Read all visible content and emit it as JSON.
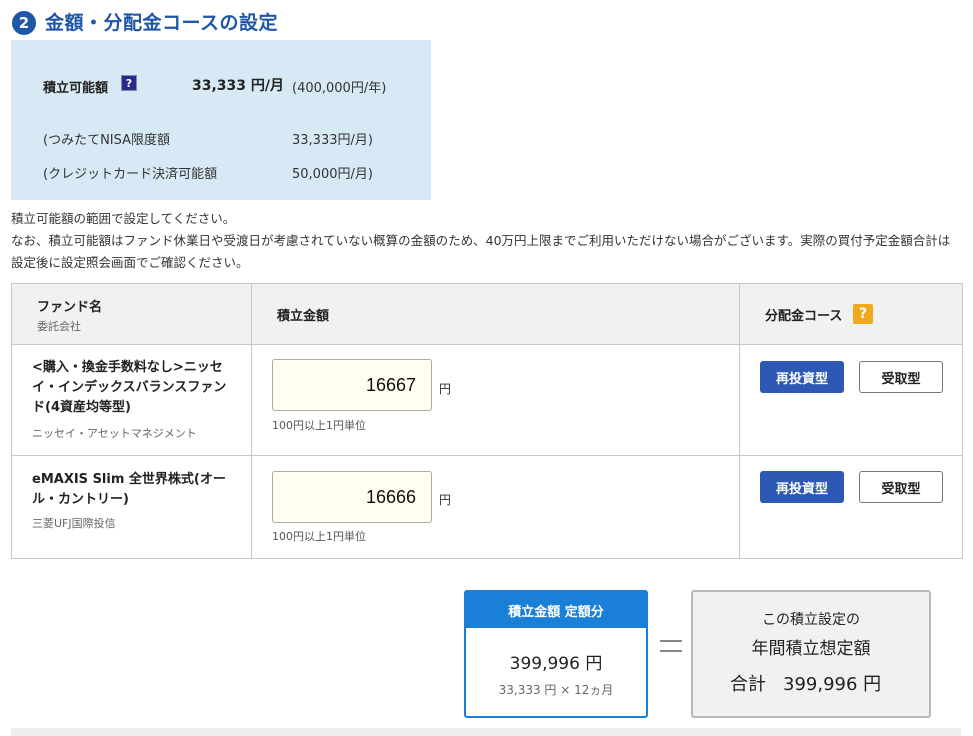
{
  "section": {
    "step": "2",
    "title": "金額・分配金コースの設定"
  },
  "info": {
    "available_label": "積立可能額",
    "available_monthly": "33,333 円/月",
    "available_yearly": "(400,000円/年)",
    "nisa_label": "(つみたてNISA限度額",
    "nisa_value": "33,333円/月)",
    "card_label": "(クレジットカード決済可能額",
    "card_value": "50,000円/月)"
  },
  "notes": {
    "line1": "積立可能額の範囲で設定してください。",
    "line2": "なお、積立可能額はファンド休業日や受渡日が考慮されていない概算の金額のため、40万円上限までご利用いただけない場合がございます。実際の買付予定金額合計は設定後に設定照会画面でご確認ください。"
  },
  "table": {
    "headers": {
      "fund": "ファンド名",
      "fund_sub": "委託会社",
      "amount": "積立金額",
      "course": "分配金コース"
    },
    "rows": [
      {
        "fund_name": "<購入・換金手数料なし>ニッセイ・インデックスバランスファンド(4資産均等型)",
        "company": "ニッセイ・アセットマネジメント",
        "amount": "16667",
        "unit": "円",
        "hint": "100円以上1円単位",
        "reinvest": "再投資型",
        "receive": "受取型"
      },
      {
        "fund_name": "eMAXIS Slim 全世界株式(オール・カントリー)",
        "company": "三菱UFJ国際投信",
        "amount": "16666",
        "unit": "円",
        "hint": "100円以上1円単位",
        "reinvest": "再投資型",
        "receive": "受取型"
      }
    ]
  },
  "summary": {
    "fixed_title": "積立金額 定額分",
    "fixed_total": "399,996 円",
    "fixed_detail": "33,333 円 × 12ヵ月",
    "annual_line1": "この積立設定の",
    "annual_line2": "年間積立想定額",
    "annual_total_label": "合計",
    "annual_total": "399,996 円"
  },
  "colors": {
    "accent": "#1f56a8",
    "info_bg": "#d7e9f5",
    "reinvest": "#2d59b4",
    "fixed_border": "#1a7fd6",
    "help_orange": "#f0a81c"
  }
}
